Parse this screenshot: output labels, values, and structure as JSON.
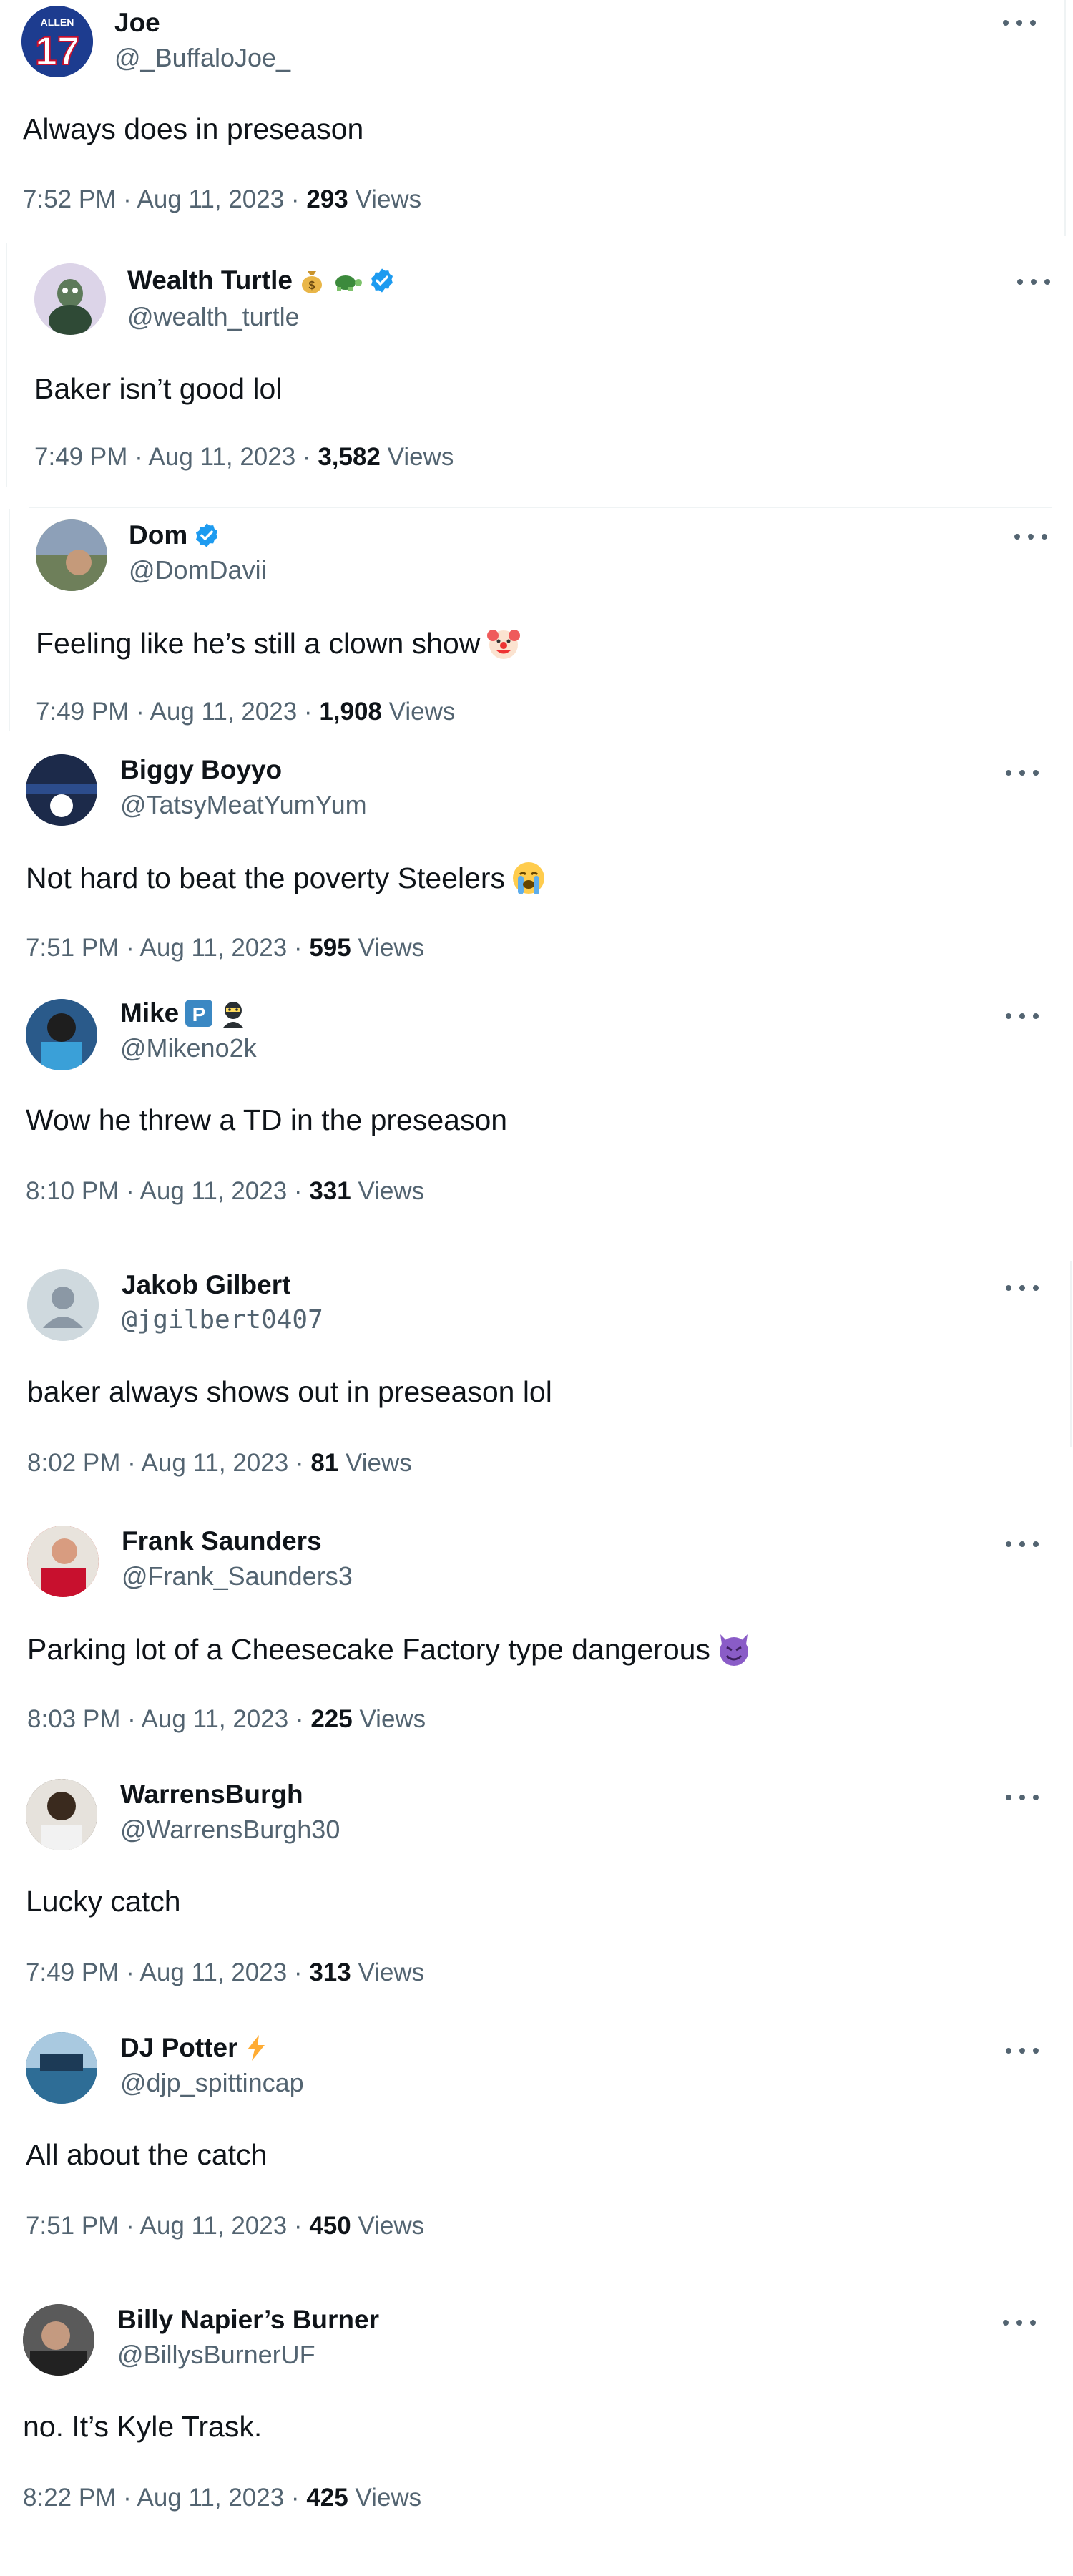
{
  "tweets": [
    {
      "name": "Joe",
      "handle": "@_BuffaloJoe_",
      "text": "Always does in preseason",
      "time": "7:52 PM",
      "date": "Aug 11, 2023",
      "views": "293",
      "views_label": "Views",
      "avatar_text": "ALLEN",
      "avatar_number": "17",
      "avatar_color": "#1d3c8f"
    },
    {
      "name": "Wealth Turtle",
      "handle": "@wealth_turtle",
      "text": "Baker isn’t good lol",
      "time": "7:49 PM",
      "date": "Aug 11, 2023",
      "views": "3,582",
      "views_label": "Views",
      "verified": true,
      "name_icons": [
        "money-bag-icon",
        "turtle-icon"
      ],
      "avatar_color": "#dcd4e8"
    },
    {
      "name": "Dom",
      "handle": "@DomDavii",
      "text": "Feeling like he’s still a clown show",
      "time": "7:49 PM",
      "date": "Aug 11, 2023",
      "views": "1,908",
      "views_label": "Views",
      "verified": true,
      "text_icon": "clown-face-icon",
      "avatar_color": "#8a9a7a"
    },
    {
      "name": "Biggy Boyyo",
      "handle": "@TatsyMeatYumYum",
      "text": "Not hard to beat the poverty Steelers",
      "time": "7:51 PM",
      "date": "Aug 11, 2023",
      "views": "595",
      "views_label": "Views",
      "text_icon": "loudly-crying-face-icon",
      "avatar_color": "#1c2a4a"
    },
    {
      "name": "Mike",
      "handle": "@Mikeno2k",
      "text": "Wow he threw a TD in the preseason",
      "time": "8:10 PM",
      "date": "Aug 11, 2023",
      "views": "331",
      "views_label": "Views",
      "name_badge": "P",
      "name_icons": [
        "ninja-icon"
      ],
      "avatar_color": "#2a5a8a"
    },
    {
      "name": "Jakob Gilbert",
      "handle": "@jgilbert0407",
      "text": "baker always shows out in preseason lol",
      "time": "8:02 PM",
      "date": "Aug 11, 2023",
      "views": "81",
      "views_label": "Views",
      "avatar_color": "#cfd9de"
    },
    {
      "name": "Frank Saunders",
      "handle": "@Frank_Saunders3",
      "text": "Parking lot of a Cheesecake Factory type dangerous",
      "time": "8:03 PM",
      "date": "Aug 11, 2023",
      "views": "225",
      "views_label": "Views",
      "text_icon": "smiling-face-with-horns-icon",
      "avatar_color": "#c8483a"
    },
    {
      "name": "WarrensBurgh",
      "handle": "@WarrensBurgh30",
      "text": "Lucky catch",
      "time": "7:49 PM",
      "date": "Aug 11, 2023",
      "views": "313",
      "views_label": "Views",
      "avatar_color": "#5a4a3a"
    },
    {
      "name": "DJ Potter",
      "handle": "@djp_spittincap",
      "text": "All about the catch",
      "time": "7:51 PM",
      "date": "Aug 11, 2023",
      "views": "450",
      "views_label": "Views",
      "name_icons": [
        "lightning-icon"
      ],
      "avatar_color": "#2e6d96"
    },
    {
      "name": "Billy Napier’s Burner",
      "handle": "@BillysBurnerUF",
      "text": "no. It’s Kyle Trask.",
      "time": "8:22 PM",
      "date": "Aug 11, 2023",
      "views": "425",
      "views_label": "Views",
      "avatar_color": "#3a3a3a"
    }
  ],
  "colors": {
    "accent": "#1d9bf0",
    "text": "#0f1419",
    "secondary": "#536471",
    "border": "#eff3f4"
  }
}
